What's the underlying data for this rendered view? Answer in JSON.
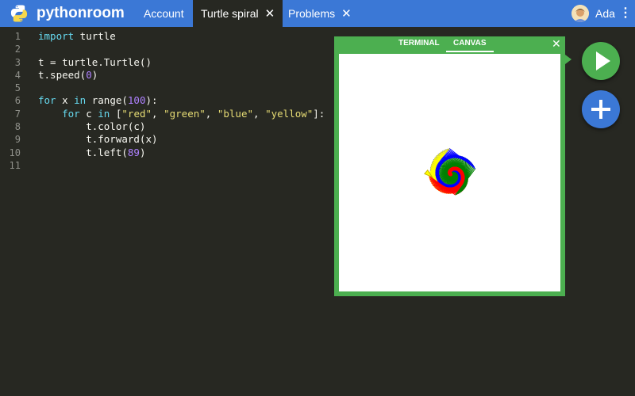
{
  "header": {
    "brand": "pythonroom",
    "tabs": [
      {
        "label": "Account",
        "closable": false,
        "active": false
      },
      {
        "label": "Turtle spiral",
        "closable": true,
        "active": true
      },
      {
        "label": "Problems",
        "closable": true,
        "active": false
      }
    ],
    "close_glyph": "✕",
    "user_name": "Ada",
    "menu_glyph": "⋮"
  },
  "editor": {
    "line_numbers": [
      "1",
      "2",
      "3",
      "4",
      "5",
      "6",
      "7",
      "8",
      "9",
      "10",
      "11"
    ],
    "lines": [
      [
        {
          "t": "import",
          "c": "kw"
        },
        {
          "t": " turtle",
          "c": ""
        }
      ],
      [],
      [
        {
          "t": "t = turtle.Turtle()",
          "c": ""
        }
      ],
      [
        {
          "t": "t.speed(",
          "c": ""
        },
        {
          "t": "0",
          "c": "num"
        },
        {
          "t": ")",
          "c": ""
        }
      ],
      [],
      [
        {
          "t": "for",
          "c": "kw"
        },
        {
          "t": " x ",
          "c": ""
        },
        {
          "t": "in",
          "c": "kw"
        },
        {
          "t": " range(",
          "c": ""
        },
        {
          "t": "100",
          "c": "num"
        },
        {
          "t": "):",
          "c": ""
        }
      ],
      [
        {
          "t": "    ",
          "c": ""
        },
        {
          "t": "for",
          "c": "kw"
        },
        {
          "t": " c ",
          "c": ""
        },
        {
          "t": "in",
          "c": "kw"
        },
        {
          "t": " [",
          "c": ""
        },
        {
          "t": "\"red\"",
          "c": "str"
        },
        {
          "t": ", ",
          "c": ""
        },
        {
          "t": "\"green\"",
          "c": "str"
        },
        {
          "t": ", ",
          "c": ""
        },
        {
          "t": "\"blue\"",
          "c": "str"
        },
        {
          "t": ", ",
          "c": ""
        },
        {
          "t": "\"yellow\"",
          "c": "str"
        },
        {
          "t": "]:",
          "c": ""
        }
      ],
      [
        {
          "t": "        t.color(c)",
          "c": ""
        }
      ],
      [
        {
          "t": "        t.forward(x)",
          "c": ""
        }
      ],
      [
        {
          "t": "        t.left(",
          "c": ""
        },
        {
          "t": "89",
          "c": "num"
        },
        {
          "t": ")",
          "c": ""
        }
      ],
      []
    ]
  },
  "output_panel": {
    "tabs": [
      "TERMINAL",
      "CANVAS"
    ],
    "active_tab": "CANVAS",
    "close_glyph": "✕",
    "canvas_drawing": {
      "colors": [
        "red",
        "green",
        "blue",
        "yellow"
      ],
      "steps": 100,
      "angle": 89
    }
  },
  "fabs": {
    "run_icon": "play-icon",
    "add_icon": "plus-icon"
  },
  "colors": {
    "header_bg": "#3b78d6",
    "editor_bg": "#272822",
    "panel_green": "#4caf50",
    "keyword": "#66d9ef",
    "string": "#e6db74",
    "number": "#ae81ff"
  }
}
